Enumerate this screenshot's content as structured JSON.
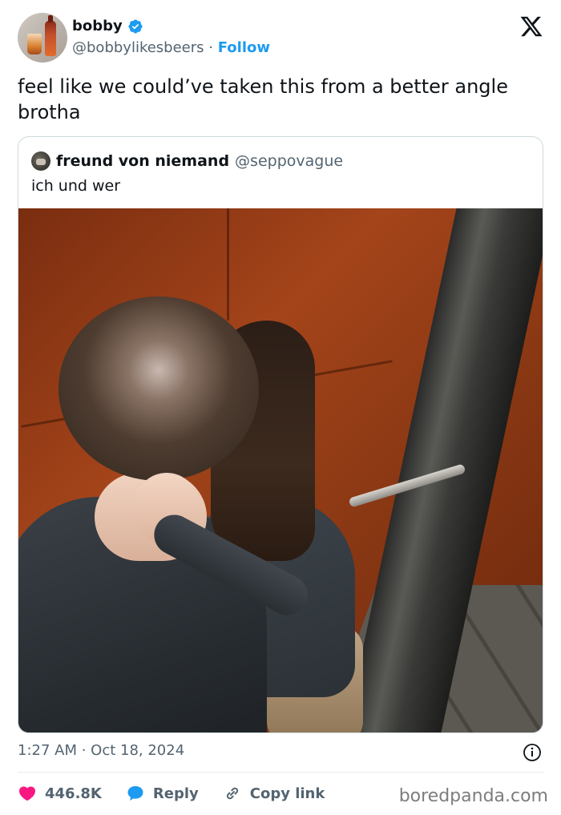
{
  "author": {
    "name": "bobby",
    "handle": "@bobbylikesbeers",
    "separator": "·",
    "follow_label": "Follow"
  },
  "tweet": {
    "text": "feel like we could’ve taken this from a better angle brotha",
    "timestamp": "1:27 AM · Oct 18, 2024"
  },
  "quoted_tweet": {
    "name": "freund von niemand",
    "handle": "@seppovague",
    "text": "ich und wer"
  },
  "actions": {
    "likes": "446.8K",
    "reply_label": "Reply",
    "copy_link_label": "Copy link"
  },
  "watermark": "boredpanda.com",
  "colors": {
    "accent": "#1d9bf0",
    "like": "#f91880",
    "muted": "#536471"
  },
  "icons": [
    "verified-badge-icon",
    "x-logo-icon",
    "info-icon",
    "heart-icon",
    "reply-bubble-icon",
    "link-icon"
  ]
}
